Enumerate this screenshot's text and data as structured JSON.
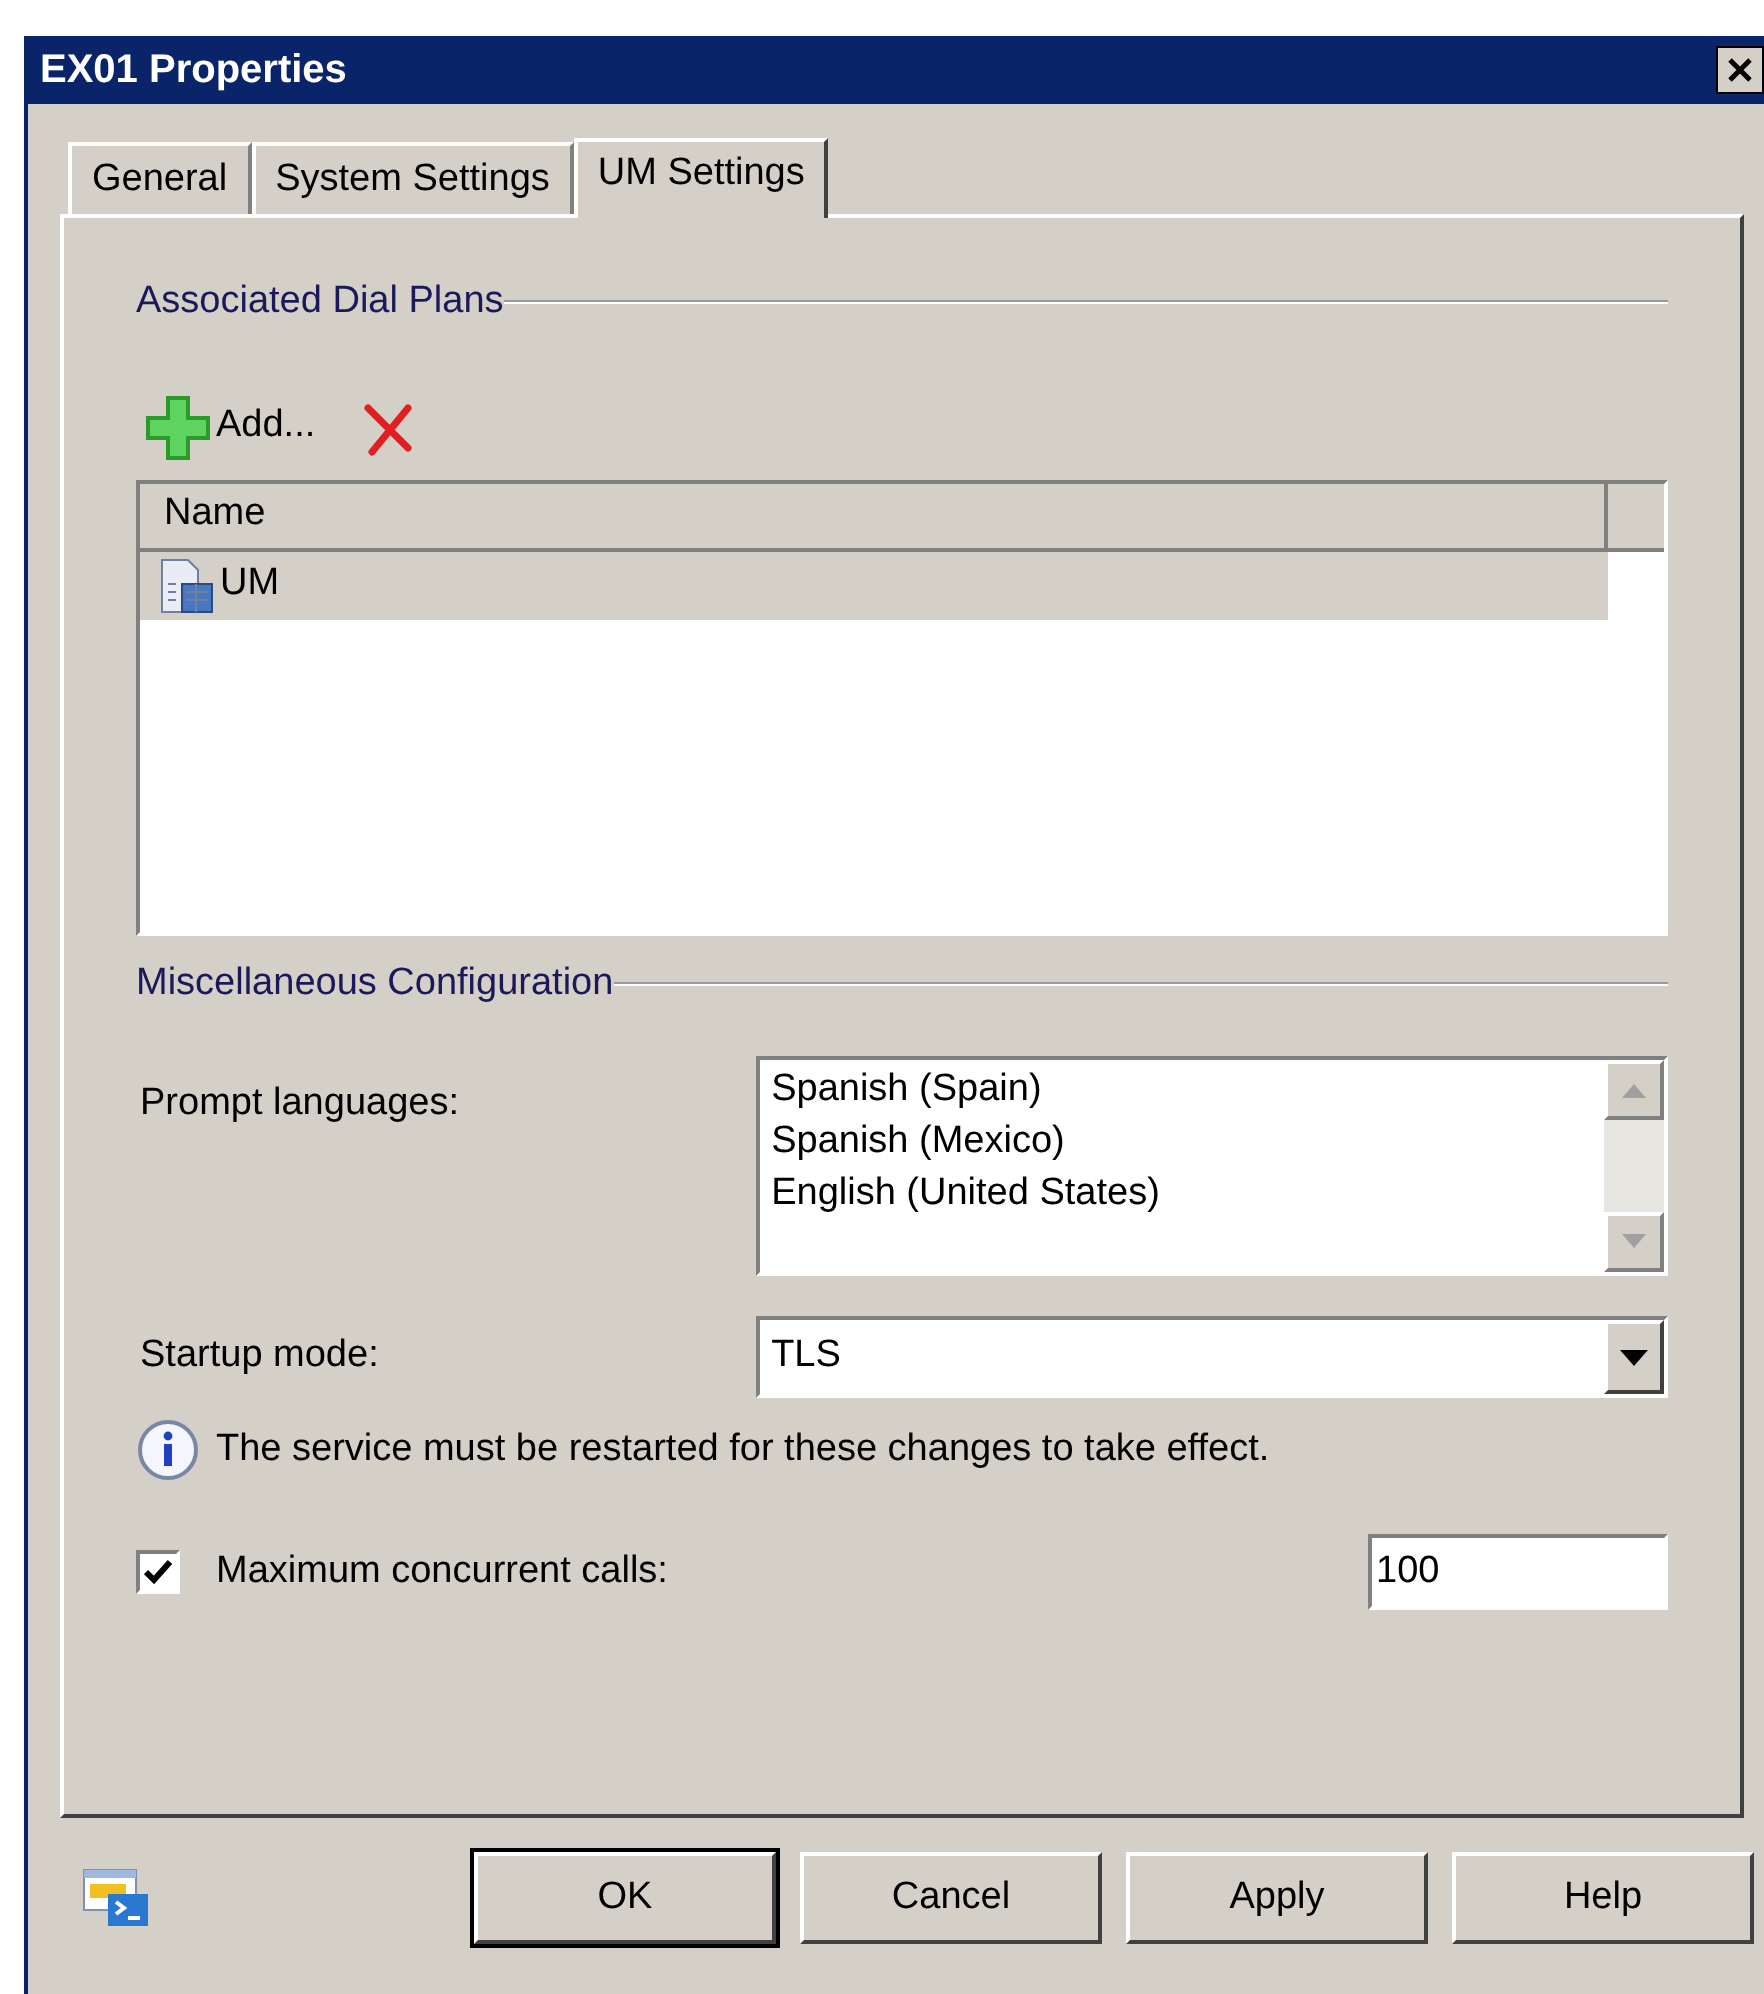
{
  "window": {
    "title": "EX01 Properties"
  },
  "tabs": [
    {
      "label": "General",
      "selected": false
    },
    {
      "label": "System Settings",
      "selected": false
    },
    {
      "label": "UM Settings",
      "selected": true
    }
  ],
  "dial_plans": {
    "heading": "Associated Dial Plans",
    "add_label": "Add...",
    "columns": [
      "Name"
    ],
    "rows": [
      {
        "name": "UM",
        "selected": true
      }
    ]
  },
  "misc": {
    "heading": "Miscellaneous Configuration",
    "prompt_languages": {
      "label": "Prompt languages:",
      "items": [
        "Spanish (Spain)",
        "Spanish (Mexico)",
        "English (United States)"
      ]
    },
    "startup_mode": {
      "label": "Startup mode:",
      "value": "TLS"
    },
    "info": "The service must be restarted for these changes to take effect.",
    "max_calls": {
      "label": "Maximum concurrent calls:",
      "checked": true,
      "value": "100"
    }
  },
  "buttons": [
    {
      "label": "OK",
      "default": true
    },
    {
      "label": "Cancel",
      "default": false
    },
    {
      "label": "Apply",
      "default": false
    },
    {
      "label": "Help",
      "default": false
    }
  ]
}
